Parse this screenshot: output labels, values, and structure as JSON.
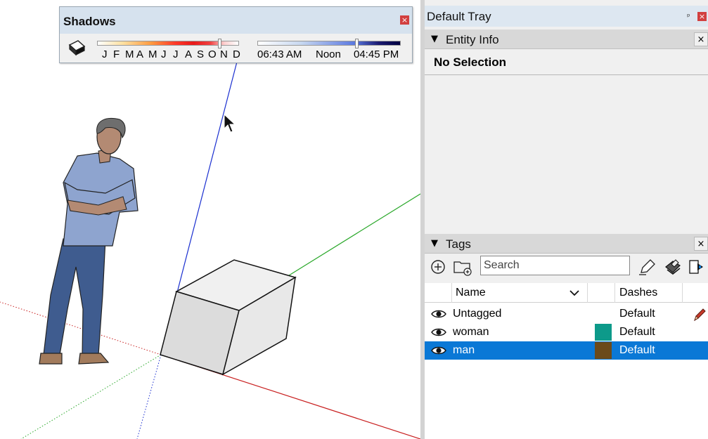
{
  "shadows": {
    "title": "Shadows",
    "close_label": "×",
    "months": [
      "J",
      "F",
      "M",
      "A",
      "M",
      "J",
      "J",
      "A",
      "S",
      "O",
      "N",
      "D"
    ],
    "month_level": 0.86,
    "time_start": "06:43 AM",
    "time_mid": "Noon",
    "time_end": "04:45 PM",
    "time_level": 0.69
  },
  "tray": {
    "title": "Default Tray",
    "pin_label": "ᵖ",
    "close_label": "×"
  },
  "entity_info": {
    "title": "Entity Info",
    "arrow": "▼",
    "close_label": "×",
    "selection": "No Selection"
  },
  "tags": {
    "title": "Tags",
    "arrow": "▼",
    "close_label": "×",
    "search_placeholder": "Search",
    "columns": {
      "name": "Name",
      "dashes": "Dashes"
    },
    "rows": [
      {
        "name": "Untagged",
        "dashes": "Default",
        "color": null,
        "selected": false
      },
      {
        "name": "woman",
        "dashes": "Default",
        "color": "#0d9a8a",
        "selected": false
      },
      {
        "name": "man",
        "dashes": "Default",
        "color": "#6b4a1a",
        "selected": true
      }
    ]
  },
  "colors": {
    "axis_blue": "#1a2fd0",
    "axis_green": "#2aa82a",
    "axis_red": "#c81e1e",
    "selection_blue": "#0a78d6"
  }
}
